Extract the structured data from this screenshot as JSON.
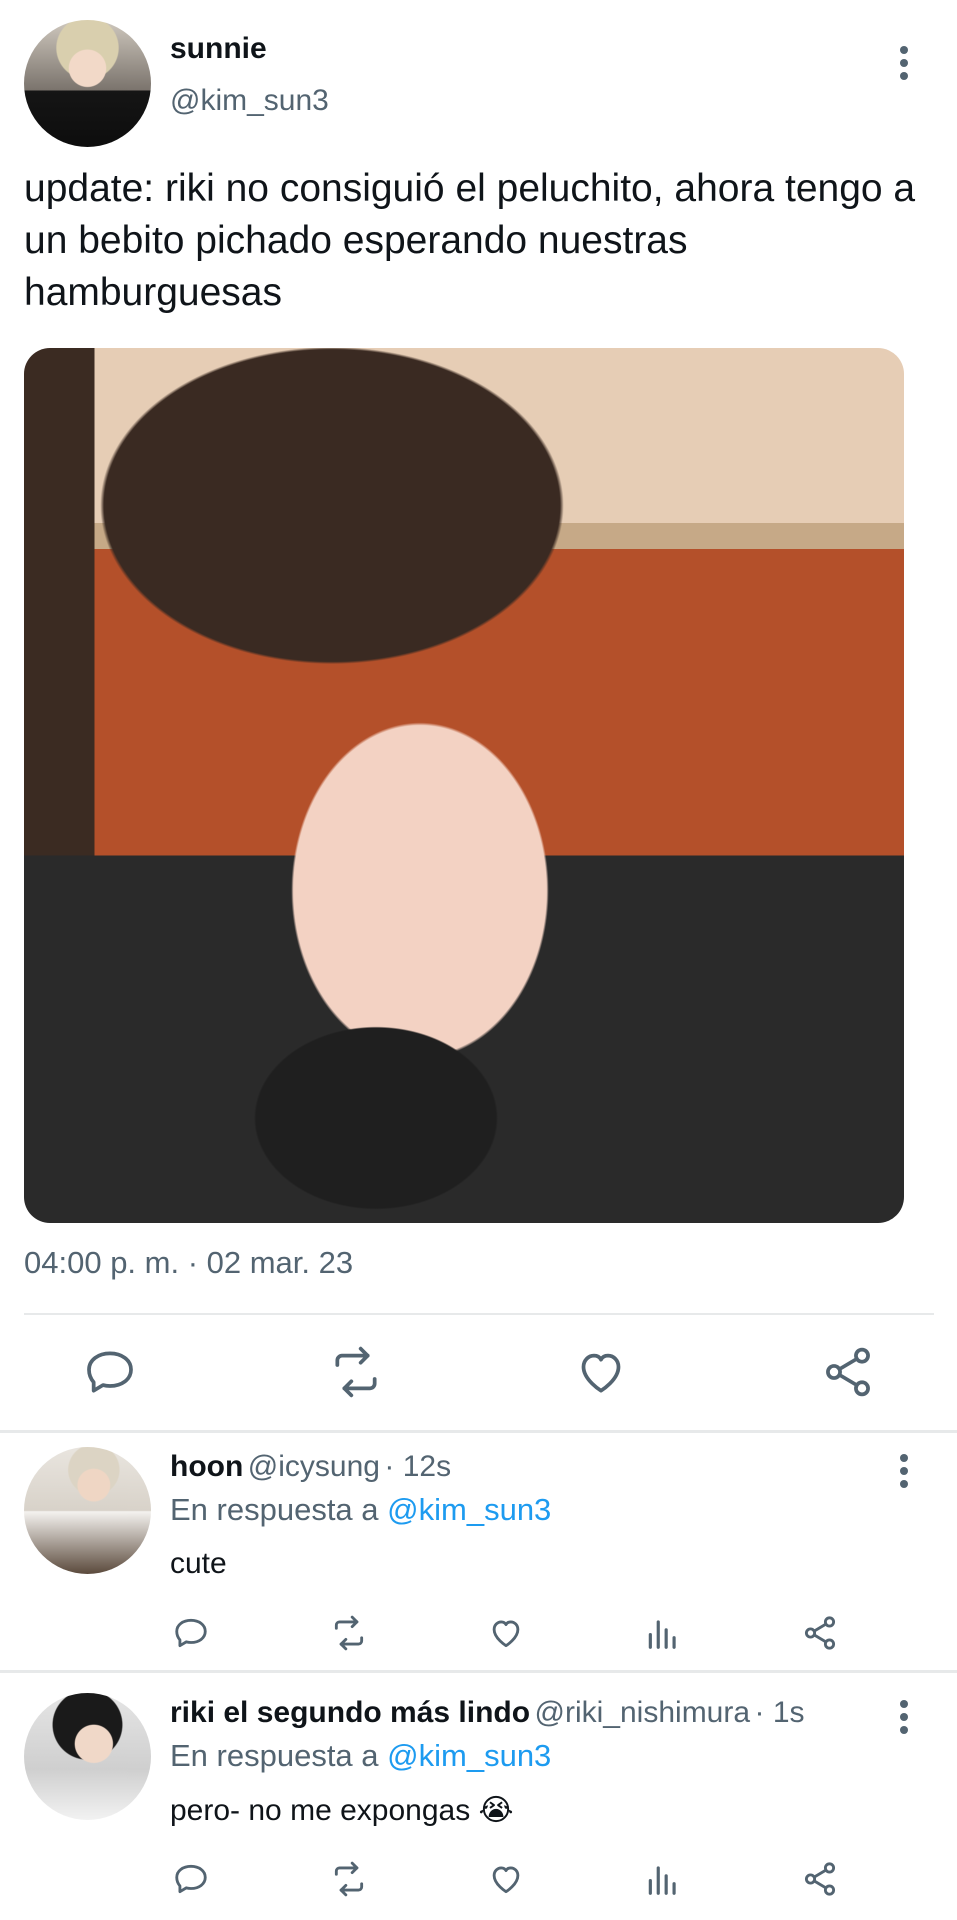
{
  "tweet": {
    "author_name": "sunnie",
    "author_handle": "@kim_sun3",
    "text": "update: riki no consiguió el peluchito, ahora tengo a un bebito pichado esperando nuestras hamburguesas",
    "timestamp": "04:00 p. m. · 02 mar. 23",
    "actions": [
      "reply-icon",
      "retweet-icon",
      "like-icon",
      "share-icon"
    ]
  },
  "replies": [
    {
      "name": "hoon",
      "handle": "@icysung",
      "time": "· 12s",
      "reply_prefix": "En respuesta a",
      "reply_to": "@kim_sun3",
      "text": "cute"
    },
    {
      "name": "riki el segundo más lindo",
      "handle": "@riki_nishimura",
      "time": "· 1s",
      "reply_prefix": "En respuesta a",
      "reply_to": "@kim_sun3",
      "text": "pero- no me expongas 😭"
    }
  ],
  "colors": {
    "text": "#0f1419",
    "secondary": "#536471",
    "link": "#1d9bf0",
    "divider": "#e7e9ea"
  }
}
